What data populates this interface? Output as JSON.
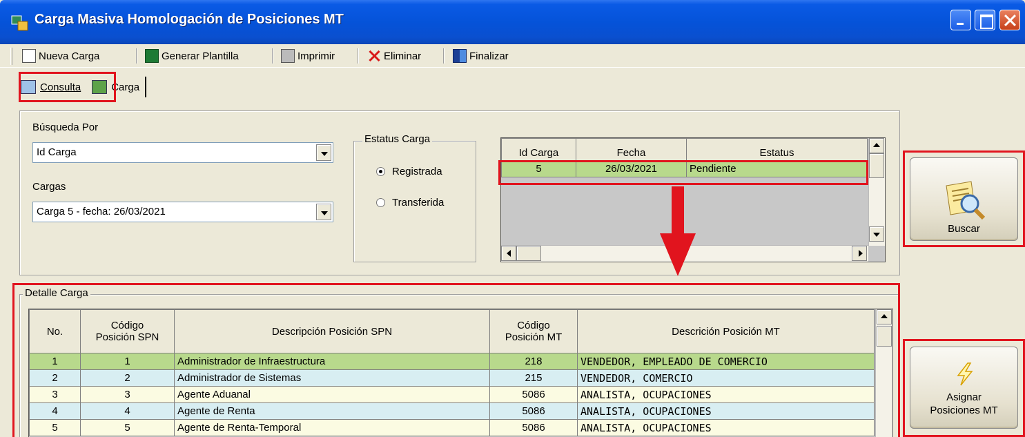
{
  "window": {
    "title": "Carga Masiva Homologación de Posiciones MT"
  },
  "toolbar": {
    "nueva_carga": "Nueva Carga",
    "generar_plantilla": "Generar Plantilla",
    "imprimir": "Imprimir",
    "eliminar": "Eliminar",
    "finalizar": "Finalizar"
  },
  "tabs": [
    {
      "label": "Consulta",
      "selected": true
    },
    {
      "label": "Carga",
      "selected": false
    }
  ],
  "consulta": {
    "busqueda_label": "Búsqueda Por",
    "busqueda_value": "Id Carga",
    "cargas_label": "Cargas",
    "cargas_value": "Carga 5 - fecha: 26/03/2021",
    "estatus_group": "Estatus Carga",
    "radio_registrada": "Registrada",
    "radio_transferida": "Transferida",
    "registrada_selected": true
  },
  "cargas_grid": {
    "columns": [
      "Id Carga",
      "Fecha",
      "Estatus"
    ],
    "rows": [
      {
        "id": "5",
        "fecha": "26/03/2021",
        "estatus": "Pendiente"
      }
    ]
  },
  "buttons": {
    "buscar": "Buscar",
    "asignar_1": "Asignar",
    "asignar_2": "Posiciones MT"
  },
  "detalle": {
    "group_label": "Detalle Carga",
    "columns": {
      "no": "No.",
      "codigo_spn_1": "Código",
      "codigo_spn_2": "Posición SPN",
      "desc_spn": "Descripción Posición SPN",
      "codigo_mt_1": "Código",
      "codigo_mt_2": "Posición MT",
      "desc_mt": "Descrición Posición MT"
    },
    "rows": [
      {
        "no": "1",
        "codigo_spn": "1",
        "desc_spn": "Administrador de Infraestructura",
        "codigo_mt": "218",
        "desc_mt": "VENDEDOR, EMPLEADO DE COMERCIO"
      },
      {
        "no": "2",
        "codigo_spn": "2",
        "desc_spn": "Administrador de Sistemas",
        "codigo_mt": "215",
        "desc_mt": "VENDEDOR, COMERCIO"
      },
      {
        "no": "3",
        "codigo_spn": "3",
        "desc_spn": "Agente Aduanal",
        "codigo_mt": "5086",
        "desc_mt": "ANALISTA, OCUPACIONES"
      },
      {
        "no": "4",
        "codigo_spn": "4",
        "desc_spn": "Agente de Renta",
        "codigo_mt": "5086",
        "desc_mt": "ANALISTA, OCUPACIONES"
      },
      {
        "no": "5",
        "codigo_spn": "5",
        "desc_spn": "Agente de Renta-Temporal",
        "codigo_mt": "5086",
        "desc_mt": "ANALISTA, OCUPACIONES"
      }
    ]
  },
  "colors": {
    "highlight": "#e1141e",
    "selected_row": "#b8d98c",
    "alt_row_a": "#d8eef2",
    "alt_row_b": "#fbfbe2",
    "title_bar": "#0553d9"
  }
}
